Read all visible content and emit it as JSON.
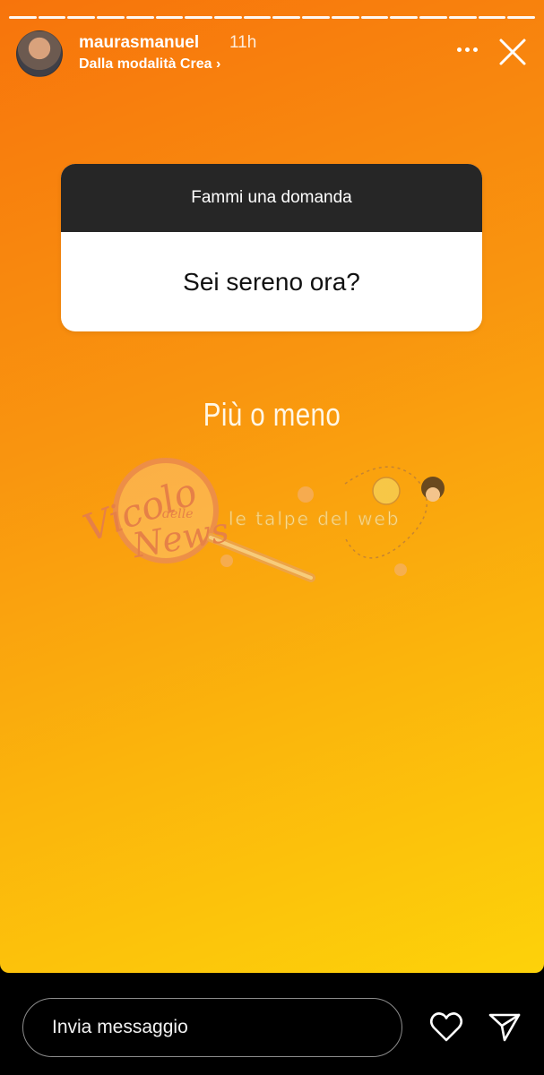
{
  "story": {
    "segments": 18,
    "username": "maurasmanuel",
    "time": "11h",
    "subtitle": "Dalla modalità Crea",
    "subtitle_chevron": "›"
  },
  "question_sticker": {
    "prompt": "Fammi una domanda",
    "question": "Sei sereno ora?"
  },
  "answer_text": "Più o meno",
  "watermark": {
    "brand1_line1": "Vicolo",
    "brand1_line2": "delle",
    "brand1_line3": "News",
    "brand2": "le talpe del web"
  },
  "footer": {
    "message_placeholder": "Invia messaggio"
  },
  "icons": {
    "avatar": "avatar",
    "more": "more-icon",
    "close": "close-icon",
    "heart": "heart-icon",
    "send": "send-icon"
  },
  "colors": {
    "gradient_start": "#f7740c",
    "gradient_end": "#fdd20a",
    "card_header": "#262626"
  }
}
